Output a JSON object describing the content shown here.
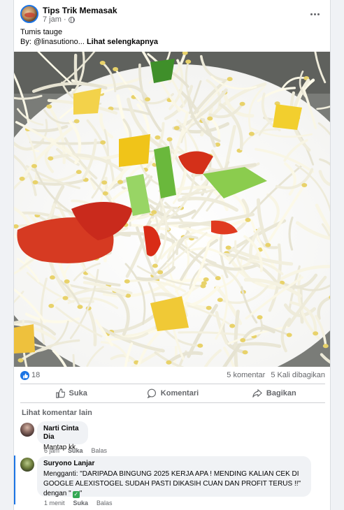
{
  "post": {
    "page_name": "Tips Trik Memasak",
    "time": "7 jam ·",
    "privacy_icon": "globe-icon",
    "more_icon": "more-options-icon",
    "caption_line1": "Tumis tauge",
    "caption_line2": "By: @linasutiono...",
    "see_more": "Lihat selengkapnya",
    "photo_description_icon": "food-photo"
  },
  "stats": {
    "like_count": "18",
    "comments": "5 komentar",
    "shares": "5 Kali dibagikan"
  },
  "actions": {
    "like": "Suka",
    "comment": "Komentari",
    "share": "Bagikan"
  },
  "comments": {
    "view_more": "Lihat komentar lain",
    "items": [
      {
        "author": "Narti Cinta Dia",
        "text": "Mantap kk",
        "time": "6 jam",
        "like": "Suka",
        "reply": "Balas"
      },
      {
        "author": "Suryono Lanjar",
        "text": "Mengganti: \"DARIPADA BINGUNG 2025 KERJA APA ! MENDING KALIAN CEK DI GOOGLE ALEXISTOGEL SUDAH PASTI DIKASIH CUAN DAN PROFIT TERUS !!\" dengan \"",
        "text_end": "\"",
        "time": "1 menit",
        "like": "Suka",
        "reply": "Balas"
      }
    ]
  },
  "colors": {
    "accent": "#1b74e4",
    "secondary_text": "#65676b",
    "bubble": "#f0f2f5"
  }
}
